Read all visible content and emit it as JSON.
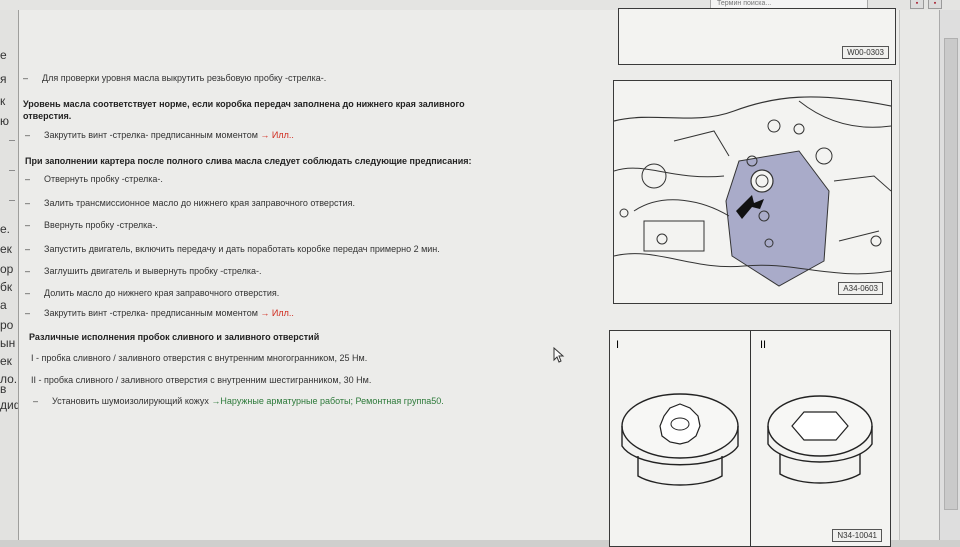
{
  "toolbar": {
    "search_text": "Термин поиска..."
  },
  "left_pane": {
    "fragments": [
      "е",
      "я",
      "к",
      "ю",
      "е.",
      "ек",
      "ор",
      "бк",
      "а",
      "ро",
      "ын",
      "ек",
      "ло.",
      "в",
      "диф"
    ]
  },
  "lines": [
    {
      "kind": "bullet",
      "text": "Для проверки уровня масла выкрутить резьбовую пробку -стрелка-."
    },
    {
      "kind": "bold",
      "text": "Уровень масла соответствует норме, если коробка передач заполнена до нижнего края заливного"
    },
    {
      "kind": "bold",
      "text": "отверстия."
    },
    {
      "kind": "bullet",
      "text": "Закрутить винт -стрелка- предписанным моментом",
      "link": "→ Илл.."
    },
    {
      "kind": "bold",
      "text": "При заполнении картера после полного слива масла следует соблюдать следующие предписания:"
    },
    {
      "kind": "bullet",
      "text": "Отвернуть пробку -стрелка-."
    },
    {
      "kind": "bullet",
      "text": "Залить трансмиссионное масло до нижнего края заправочного отверстия."
    },
    {
      "kind": "bullet",
      "text": "Ввернуть пробку -стрелка-."
    },
    {
      "kind": "bullet",
      "text": "Запустить двигатель, включить передачу и дать поработать коробке передач примерно 2 мин."
    },
    {
      "kind": "bullet",
      "text": "Заглушить двигатель и вывернуть пробку -стрелка-."
    },
    {
      "kind": "bullet",
      "text": "Долить масло до нижнего края заправочного отверстия."
    },
    {
      "kind": "bullet",
      "text": "Закрутить винт -стрелка- предписанным моментом",
      "link": "→ Илл.."
    },
    {
      "kind": "bold",
      "text": "Различные исполнения пробок сливного и заливного отверстий"
    },
    {
      "kind": "plain",
      "text": "I - пробка сливного / заливного отверстия с внутренним многогранником, 25 Нм."
    },
    {
      "kind": "plain",
      "text": "II - пробка сливного / заливного отверстия с внутренним шестигранником, 30 Нм."
    },
    {
      "kind": "bullet",
      "text": "Установить шумоизолирующий кожух",
      "link": "→Наружные арматурные работы; Ремонтная группа50."
    }
  ],
  "figures": {
    "top": {
      "label": "W00-0303"
    },
    "middle": {
      "label": "A34-0603"
    },
    "bottom": {
      "label": "N34-10041",
      "panel_1": "I",
      "panel_2": "II"
    }
  }
}
